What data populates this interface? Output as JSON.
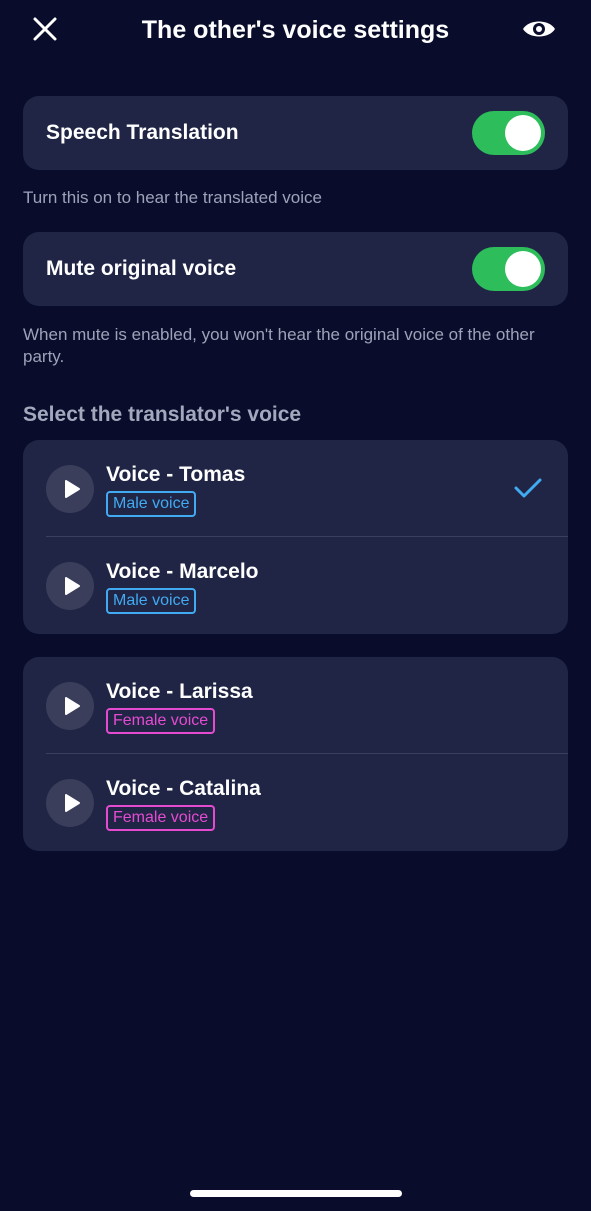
{
  "header": {
    "title": "The other's voice settings",
    "close_icon": "close-icon",
    "eye_icon": "eye-icon"
  },
  "speech_translation": {
    "label": "Speech Translation",
    "enabled": true,
    "helper": "Turn this on to hear the translated voice"
  },
  "mute_original": {
    "label": "Mute original voice",
    "enabled": true,
    "helper": "When mute is enabled, you won't hear the original voice of the other party."
  },
  "voice_section": {
    "title": "Select the translator's voice",
    "male_voices": [
      {
        "name": "Voice - Tomas",
        "tag": "Male voice",
        "selected": true
      },
      {
        "name": "Voice - Marcelo",
        "tag": "Male voice",
        "selected": false
      }
    ],
    "female_voices": [
      {
        "name": "Voice - Larissa",
        "tag": "Female voice",
        "selected": false
      },
      {
        "name": "Voice - Catalina",
        "tag": "Female voice",
        "selected": false
      }
    ]
  },
  "colors": {
    "background": "#090d2b",
    "card": "#202546",
    "toggle_on": "#2dbd5a",
    "male_badge": "#41aaf0",
    "female_badge": "#e54bd0",
    "check": "#41aaf0"
  }
}
